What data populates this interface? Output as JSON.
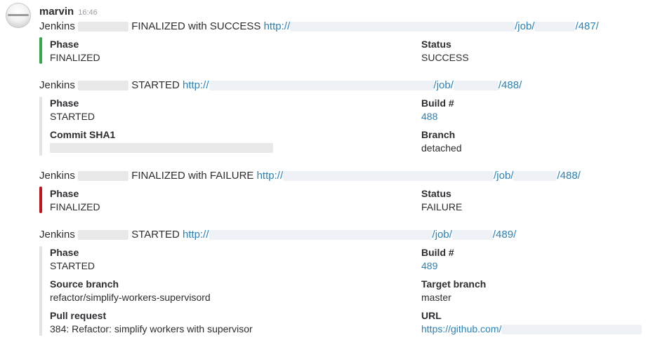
{
  "message": {
    "sender": "marvin",
    "time": "16:46"
  },
  "colors": {
    "link": "#2a80b9",
    "success": "#36a64f",
    "failure": "#c0141e",
    "neutral": "#e3e3e3"
  },
  "blocks": [
    {
      "prefix": "Jenkins",
      "status_text": "FINALIZED with SUCCESS",
      "link_start": "http://",
      "link_mid": "/job/",
      "link_end": "/487/",
      "fields": [
        {
          "title": "Phase",
          "value": "FINALIZED"
        },
        {
          "title": "Status",
          "value": "SUCCESS"
        }
      ]
    },
    {
      "prefix": "Jenkins",
      "status_text": "STARTED",
      "link_start": "http://",
      "link_mid": "/job/",
      "link_end": "/488/",
      "fields": [
        {
          "title": "Phase",
          "value": "STARTED"
        },
        {
          "title": "Build #",
          "value": "488"
        },
        {
          "title": "Commit SHA1",
          "value": ""
        },
        {
          "title": "Branch",
          "value": "detached"
        }
      ]
    },
    {
      "prefix": "Jenkins",
      "status_text": "FINALIZED with FAILURE",
      "link_start": "http://",
      "link_mid": "/job/",
      "link_end": "/488/",
      "fields": [
        {
          "title": "Phase",
          "value": "FINALIZED"
        },
        {
          "title": "Status",
          "value": "FAILURE"
        }
      ]
    },
    {
      "prefix": "Jenkins",
      "status_text": "STARTED",
      "link_start": "http://",
      "link_mid": "/job/",
      "link_end": "/489/",
      "fields": [
        {
          "title": "Phase",
          "value": "STARTED"
        },
        {
          "title": "Build #",
          "value": "489"
        },
        {
          "title": "Source branch",
          "value": "refactor/simplify-workers-supervisord"
        },
        {
          "title": "Target branch",
          "value": "master"
        },
        {
          "title": "Pull request",
          "value": "384: Refactor: simplify workers with supervisor"
        },
        {
          "title": "URL",
          "value": "https://github.com/"
        }
      ]
    }
  ]
}
